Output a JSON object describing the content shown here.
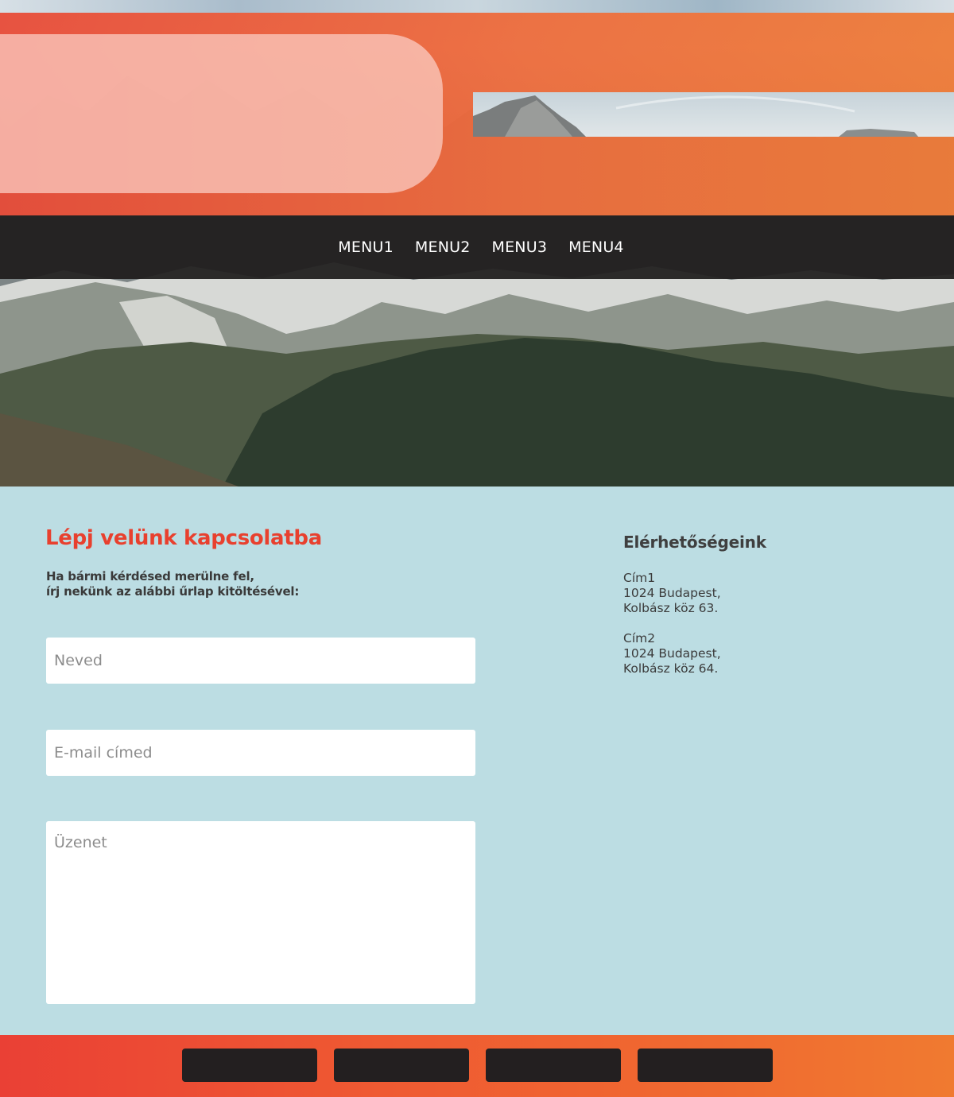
{
  "nav": {
    "items": [
      {
        "label": "MENU1"
      },
      {
        "label": "MENU2"
      },
      {
        "label": "MENU3"
      },
      {
        "label": "MENU4"
      }
    ]
  },
  "contact": {
    "title": "Lépj velünk kapcsolatba",
    "intro_line1": "Ha bármi kérdésed merülne fel,",
    "intro_line2": "írj nekünk az alábbi űrlap kitöltésével:",
    "form": {
      "name_placeholder": "Neved",
      "email_placeholder": "E-mail címed",
      "message_placeholder": "Üzenet"
    }
  },
  "info": {
    "title": "Elérhetőségeink",
    "addresses": [
      {
        "label": "Cím1",
        "city": "1024 Budapest,",
        "street": "Kolbász köz 63."
      },
      {
        "label": "Cím2",
        "city": "1024 Budapest,",
        "street": "Kolbász köz 64."
      }
    ]
  },
  "colors": {
    "accent": "#e8402e",
    "orange_band_start": "#ea4a36",
    "orange_band_end": "#f07a35",
    "nav_bg": "#1e1c1c",
    "contact_bg": "#bcdde3",
    "footer_button": "#231f20"
  }
}
